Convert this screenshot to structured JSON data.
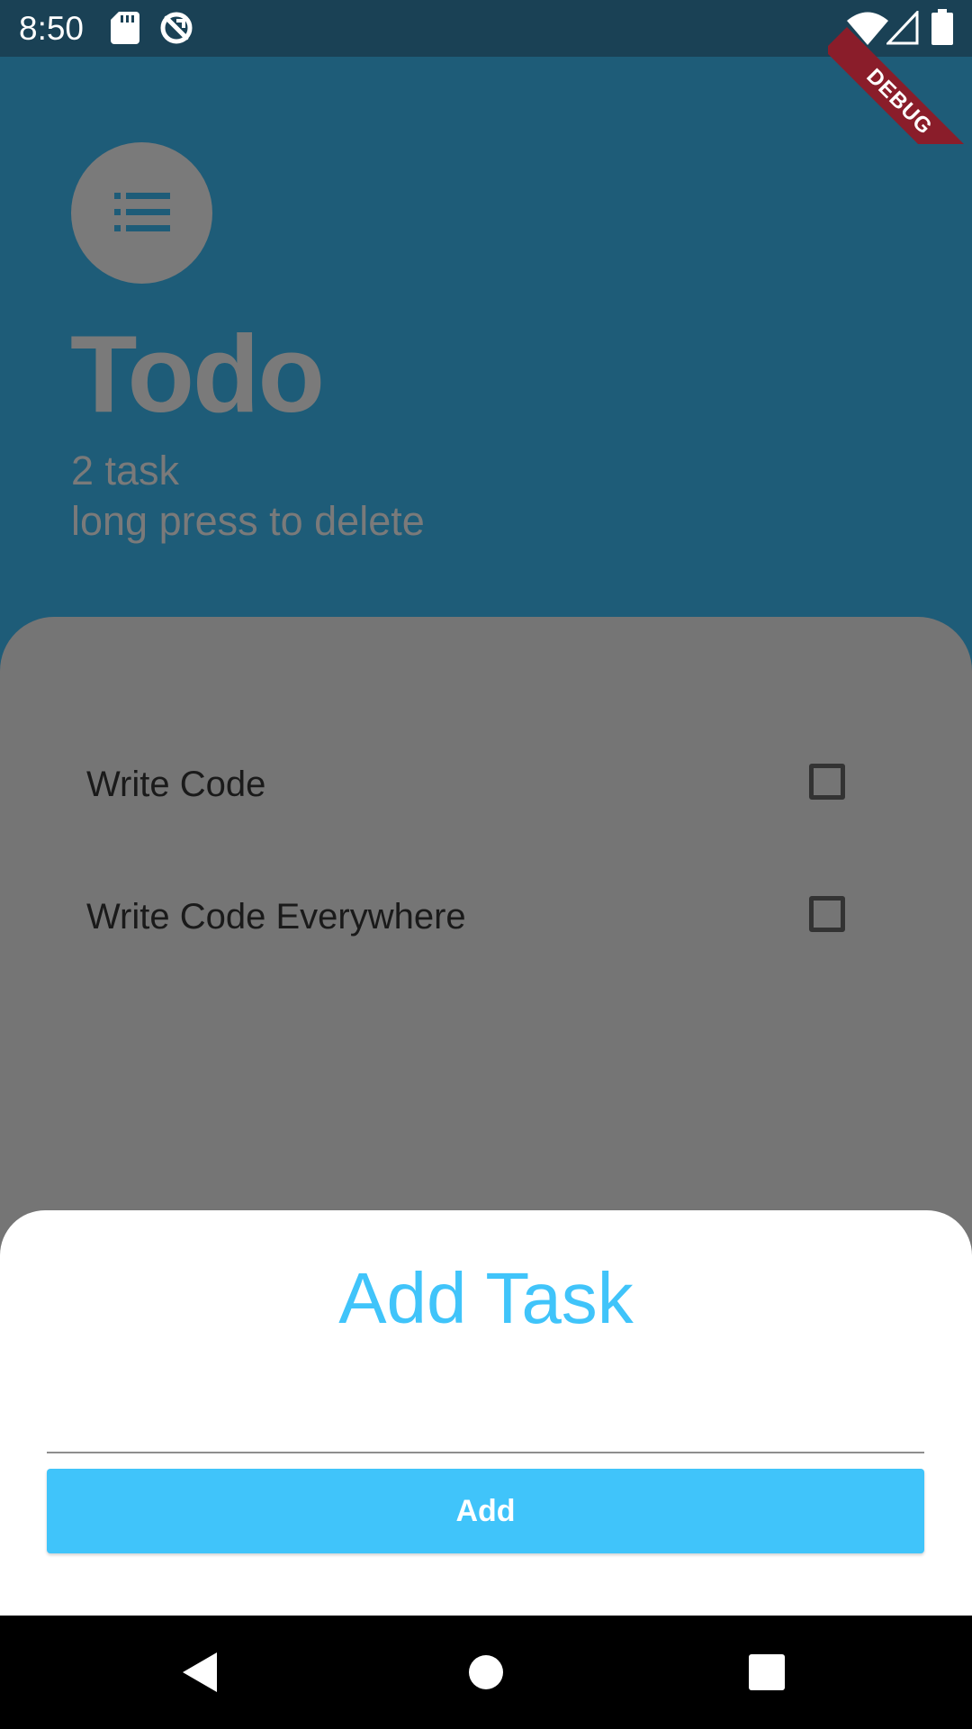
{
  "status_bar": {
    "time": "8:50",
    "icons": [
      "sd-card-icon",
      "sync-icon",
      "wifi-icon",
      "signal-icon",
      "battery-icon"
    ]
  },
  "debug_banner": {
    "label": "DEBUG",
    "color": "#8a1d2a"
  },
  "header": {
    "avatar_icon": "list-icon",
    "title": "Todo",
    "task_count": "2 task",
    "hint": "long press to delete"
  },
  "tasks": [
    {
      "label": "Write Code",
      "checked": false
    },
    {
      "label": "Write Code Everywhere",
      "checked": false
    }
  ],
  "add_sheet": {
    "title": "Add Task",
    "input_value": "",
    "input_placeholder": "",
    "button_label": "Add"
  },
  "nav_bar": {
    "icons": [
      "back-icon",
      "home-icon",
      "recents-icon"
    ]
  },
  "colors": {
    "header_background": "#1e5c78",
    "status_bar": "#1a4155",
    "panel_background": "#757575",
    "accent": "#40c4fa",
    "muted_text": "#7a7a7a"
  }
}
